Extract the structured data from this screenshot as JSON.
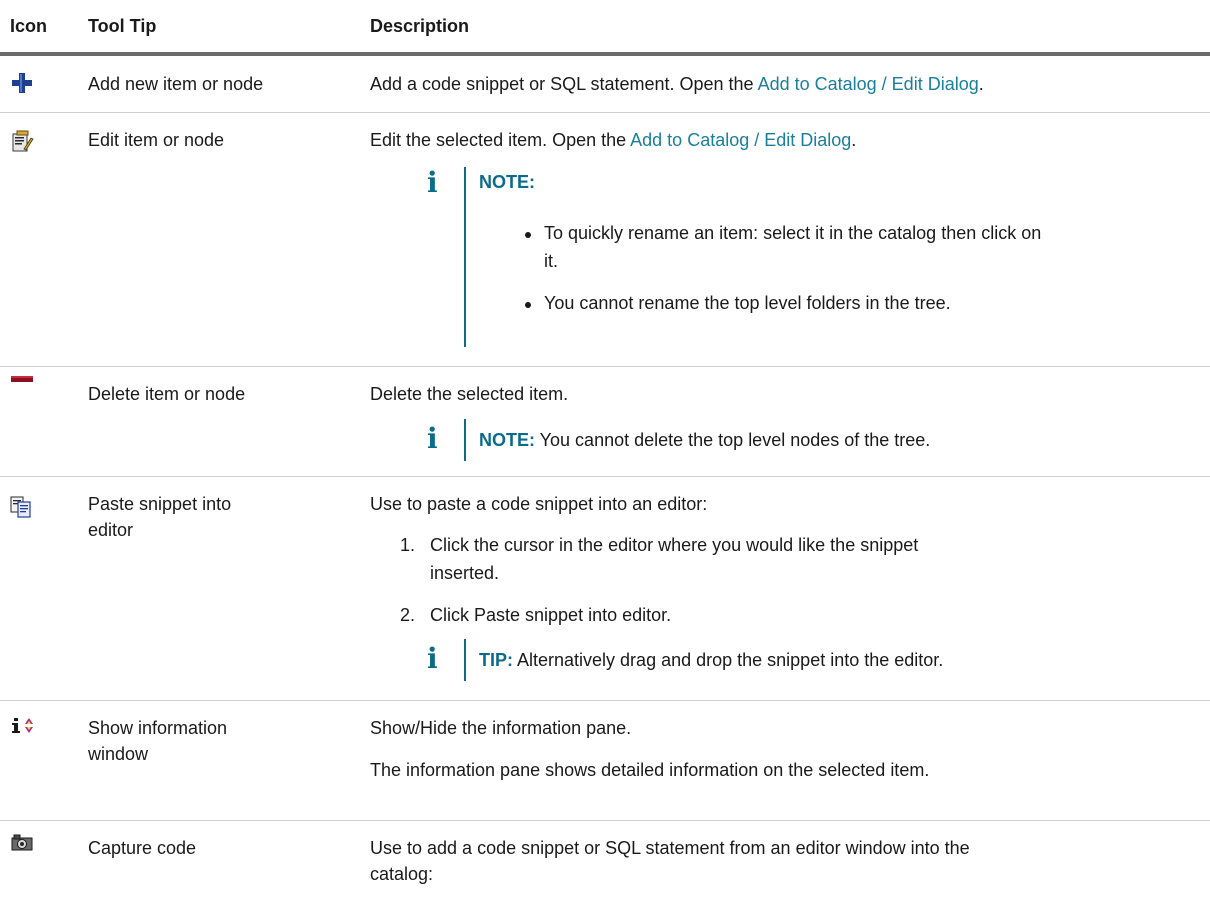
{
  "columns": {
    "icon": "Icon",
    "tooltip": "Tool Tip",
    "description": "Description"
  },
  "rows": [
    {
      "icon": "add-plus-icon",
      "tooltip": "Add new item or node",
      "desc": {
        "text": "Add a code snippet or SQL statement. Open the ",
        "link": "Add to Catalog / Edit Dialog",
        "end": "."
      }
    },
    {
      "icon": "edit-item-icon",
      "tooltip": "Edit item or node",
      "desc": {
        "text": "Edit the selected item. Open the ",
        "link": "Add to Catalog / Edit Dialog",
        "end": "."
      },
      "note": {
        "label": "NOTE:",
        "bullets": [
          "To quickly rename an item: select it in the catalog then click on",
          "it.",
          "You cannot rename the top level folders in the tree."
        ]
      }
    },
    {
      "icon": "delete-minus-icon",
      "tooltip": "Delete item or node",
      "desc": {
        "text": "Delete the selected item."
      },
      "note": {
        "label": "NOTE:",
        "text": " You cannot delete the top level nodes of the tree."
      }
    },
    {
      "icon": "paste-icon",
      "tooltip_lines": [
        "Paste snippet into",
        "editor"
      ],
      "desc": {
        "text": "Use to paste a code snippet into an editor:"
      },
      "steps": [
        {
          "n": "1.",
          "lines": [
            "Click the cursor in the editor where you would like the snippet",
            "inserted."
          ]
        },
        {
          "n": "2.",
          "lines": [
            "Click Paste snippet into editor."
          ]
        }
      ],
      "tip": {
        "label": "TIP:",
        "text": " Alternatively drag and drop the snippet into the editor."
      }
    },
    {
      "icon": "info-toggle-icon",
      "tooltip_lines": [
        "Show information",
        "window"
      ],
      "desc_lines": [
        "Show/Hide the information pane.",
        "The information pane shows detailed information on the selected item."
      ]
    },
    {
      "icon": "camera-icon",
      "tooltip": "Capture code",
      "desc_lines": [
        "Use to add a code snippet or SQL statement from an editor window into the",
        "catalog:"
      ]
    }
  ],
  "colors": {
    "link": "#1a7f9a",
    "note_accent": "#0d6b8a",
    "header_rule": "#6b6b6b"
  }
}
